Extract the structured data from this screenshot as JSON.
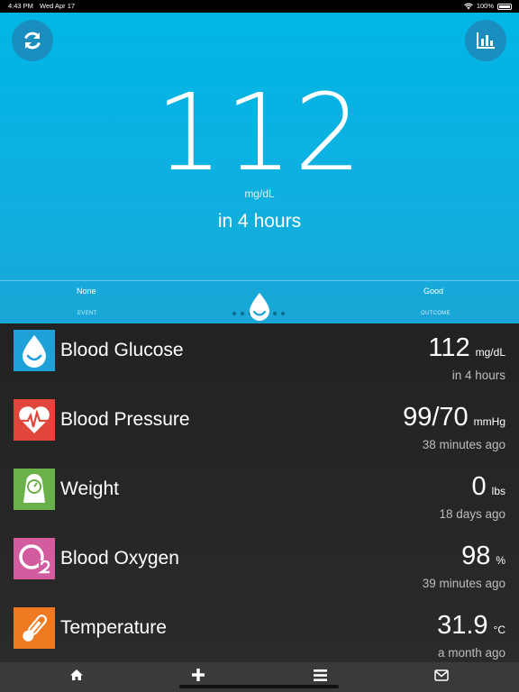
{
  "status_bar": {
    "time": "4:43 PM",
    "date": "Wed Apr 17",
    "battery": "100%"
  },
  "hero": {
    "value": "112",
    "unit": "mg/dL",
    "when": "in 4 hours",
    "event_value": "None",
    "event_label": "EVENT",
    "outcome_value": "Good",
    "outcome_label": "OUTCOME",
    "page_dots": 6,
    "active_dot": 3
  },
  "metrics": [
    {
      "name": "Blood Glucose",
      "value": "112",
      "unit": "mg/dL",
      "time": "in 4 hours",
      "icon": "water-drop-icon",
      "color": "#1ea0d8"
    },
    {
      "name": "Blood Pressure",
      "value": "99/70",
      "unit": "mmHg",
      "time": "38 minutes ago",
      "icon": "heart-pulse-icon",
      "color": "#e0463b"
    },
    {
      "name": "Weight",
      "value": "0",
      "unit": "lbs",
      "time": "18 days ago",
      "icon": "scale-icon",
      "color": "#6ab14a"
    },
    {
      "name": "Blood Oxygen",
      "value": "98",
      "unit": "%",
      "time": "39 minutes ago",
      "icon": "oxygen-o2-icon",
      "color": "#d35c9f"
    },
    {
      "name": "Temperature",
      "value": "31.9",
      "unit": "°C",
      "time": "a month ago",
      "icon": "thermometer-icon",
      "color": "#ef7a22"
    }
  ],
  "tabs": [
    {
      "icon": "home-icon"
    },
    {
      "icon": "plus-icon"
    },
    {
      "icon": "menu-icon"
    },
    {
      "icon": "mail-icon"
    }
  ],
  "colors": {
    "hero_bg": "#01b6e6",
    "list_bg": "#222222",
    "tab_bg": "#3a3a3a"
  }
}
